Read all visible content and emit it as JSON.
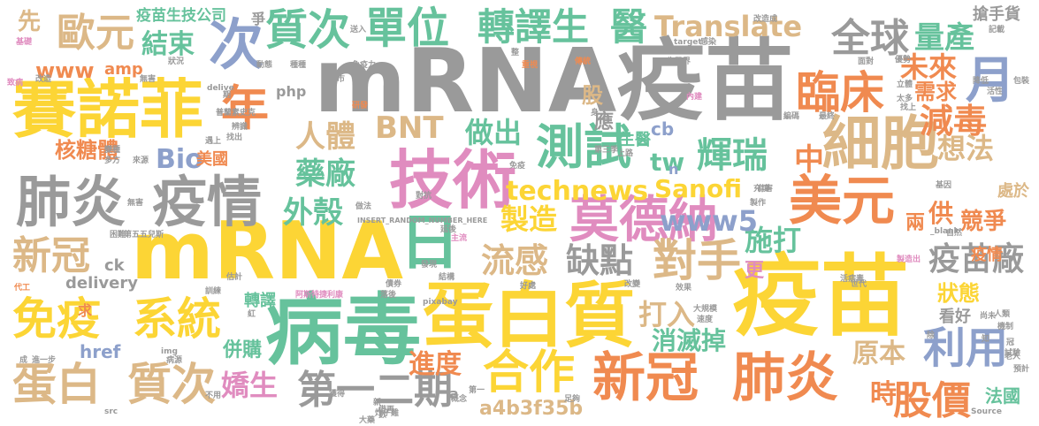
{
  "palette": {
    "gray": "#9a9a9a",
    "yellow": "#fcd535",
    "green": "#66c29c",
    "orange": "#f08a50",
    "tan": "#dcb887",
    "pink": "#e08cbf",
    "blue": "#8da0cb",
    "lime": "#a6d34f"
  },
  "words": [
    {
      "text": "mRNA疫苗",
      "color": "gray"
    },
    {
      "text": "賽諾菲",
      "color": "yellow"
    },
    {
      "text": "技術",
      "color": "pink"
    },
    {
      "text": "mRNA",
      "color": "yellow"
    },
    {
      "text": "日",
      "color": "green"
    },
    {
      "text": "病毒",
      "color": "green"
    },
    {
      "text": "蛋白質",
      "color": "yellow"
    },
    {
      "text": "疫苗",
      "color": "yellow"
    },
    {
      "text": "肺炎",
      "color": "gray"
    },
    {
      "text": "疫情",
      "color": "gray"
    },
    {
      "text": "細胞",
      "color": "tan"
    },
    {
      "text": "質次",
      "color": "green"
    },
    {
      "text": "單位",
      "color": "green"
    },
    {
      "text": "轉譯生",
      "color": "green"
    },
    {
      "text": "醫",
      "color": "green"
    },
    {
      "text": "次",
      "color": "blue"
    },
    {
      "text": "歐元",
      "color": "tan"
    },
    {
      "text": "年",
      "color": "orange"
    },
    {
      "text": "測試",
      "color": "green"
    },
    {
      "text": "莫德納",
      "color": "pink"
    },
    {
      "text": "美元",
      "color": "orange"
    },
    {
      "text": "臨床",
      "color": "orange"
    },
    {
      "text": "全球",
      "color": "gray"
    },
    {
      "text": "量產",
      "color": "green"
    },
    {
      "text": "月",
      "color": "blue"
    },
    {
      "text": "Translate",
      "color": "tan"
    },
    {
      "text": "疫苗生技公司",
      "color": "green"
    },
    {
      "text": "結束",
      "color": "green"
    },
    {
      "text": "www",
      "color": "orange"
    },
    {
      "text": "amp",
      "color": "orange"
    },
    {
      "text": "Bio",
      "color": "blue"
    },
    {
      "text": "BNT",
      "color": "tan"
    },
    {
      "text": "人體",
      "color": "tan"
    },
    {
      "text": "核糖體",
      "color": "orange"
    },
    {
      "text": "美國",
      "color": "orange"
    },
    {
      "text": "外殼",
      "color": "green"
    },
    {
      "text": "藥廠",
      "color": "green"
    },
    {
      "text": "technews",
      "color": "yellow"
    },
    {
      "text": "Sanofi",
      "color": "yellow"
    },
    {
      "text": "做出",
      "color": "green"
    },
    {
      "text": "tw",
      "color": "green"
    },
    {
      "text": "輝瑞",
      "color": "green"
    },
    {
      "text": "製造",
      "color": "yellow"
    },
    {
      "text": "施打",
      "color": "green"
    },
    {
      "text": "新冠",
      "color": "tan"
    },
    {
      "text": "新冠",
      "color": "orange"
    },
    {
      "text": "肺炎",
      "color": "orange"
    },
    {
      "text": "免疫",
      "color": "yellow"
    },
    {
      "text": "系統",
      "color": "yellow"
    },
    {
      "text": "蛋白",
      "color": "tan"
    },
    {
      "text": "質次",
      "color": "tan"
    },
    {
      "text": "流感",
      "color": "tan"
    },
    {
      "text": "缺點",
      "color": "gray"
    },
    {
      "text": "對手",
      "color": "tan"
    },
    {
      "text": "www5",
      "color": "blue"
    },
    {
      "text": "疫苗廠",
      "color": "gray"
    },
    {
      "text": "合作",
      "color": "yellow"
    },
    {
      "text": "第一二期",
      "color": "gray"
    },
    {
      "text": "進度",
      "color": "orange"
    },
    {
      "text": "打入",
      "color": "tan"
    },
    {
      "text": "消滅掉",
      "color": "green"
    },
    {
      "text": "股價",
      "color": "orange"
    },
    {
      "text": "利用",
      "color": "blue"
    },
    {
      "text": "嬌生",
      "color": "pink"
    },
    {
      "text": "減毒",
      "color": "orange"
    },
    {
      "text": "想法",
      "color": "tan"
    },
    {
      "text": "未來",
      "color": "orange"
    },
    {
      "text": "需求",
      "color": "orange"
    },
    {
      "text": "原本",
      "color": "tan"
    },
    {
      "text": "a4b3f35b",
      "color": "tan"
    },
    {
      "text": "delivery",
      "color": "gray"
    },
    {
      "text": "href",
      "color": "blue"
    },
    {
      "text": "併購",
      "color": "green"
    },
    {
      "text": "轉譯",
      "color": "green"
    },
    {
      "text": "狀態",
      "color": "yellow"
    },
    {
      "text": "看好",
      "color": "gray"
    },
    {
      "text": "法國",
      "color": "green"
    },
    {
      "text": "時",
      "color": "orange"
    },
    {
      "text": "競爭",
      "color": "orange"
    },
    {
      "text": "處於",
      "color": "tan"
    },
    {
      "text": "搶手貨",
      "color": "gray"
    },
    {
      "text": "ck",
      "color": "gray"
    },
    {
      "text": "php",
      "color": "gray"
    },
    {
      "text": "先",
      "color": "tan"
    },
    {
      "text": "爭",
      "color": "gray"
    },
    {
      "text": "股",
      "color": "tan"
    },
    {
      "text": "cb",
      "color": "blue"
    },
    {
      "text": "生醫",
      "color": "green"
    },
    {
      "text": "應",
      "color": "gray"
    },
    {
      "text": "求",
      "color": "orange"
    },
    {
      "text": "更",
      "color": "pink"
    },
    {
      "text": "疫情",
      "color": "orange"
    },
    {
      "text": "INSERT_RANDOM_NUMBER_HERE",
      "color": "gray"
    },
    {
      "text": "pixabay",
      "color": "gray"
    },
    {
      "text": "src",
      "color": "gray"
    },
    {
      "text": "Source",
      "color": "gray"
    },
    {
      "text": "img",
      "color": "gray"
    },
    {
      "text": "delive",
      "color": "gray"
    },
    {
      "text": "兩",
      "color": "orange"
    },
    {
      "text": "中",
      "color": "orange"
    },
    {
      "text": "供",
      "color": "orange"
    },
    {
      "text": "n",
      "color": "blue"
    },
    {
      "text": "a",
      "color": "gray"
    },
    {
      "text": "基礎",
      "color": "pink"
    },
    {
      "text": "致病",
      "color": "pink"
    },
    {
      "text": "代工",
      "color": "orange"
    },
    {
      "text": "成",
      "color": "gray"
    },
    {
      "text": "進一步",
      "color": "gray"
    },
    {
      "text": "預計",
      "color": "gray"
    },
    {
      "text": "包裝",
      "color": "gray"
    },
    {
      "text": "記載",
      "color": "gray"
    },
    {
      "text": "炸子雞",
      "color": "gray"
    },
    {
      "text": "阿斯特捷利康",
      "color": "pink"
    },
    {
      "text": "送入",
      "color": "gray"
    },
    {
      "text": "上市",
      "color": "gray"
    },
    {
      "text": "無害",
      "color": "gray"
    },
    {
      "text": "效果",
      "color": "gray"
    },
    {
      "text": "第三季",
      "color": "gray"
    },
    {
      "text": "改造成",
      "color": "gray"
    },
    {
      "text": "生醫界",
      "color": "gray"
    },
    {
      "text": "概念",
      "color": "gray"
    },
    {
      "text": "足夠",
      "color": "gray"
    },
    {
      "text": "主流",
      "color": "pink"
    },
    {
      "text": "免疫力",
      "color": "gray"
    },
    {
      "text": "製造出",
      "color": "pink"
    },
    {
      "text": "發現",
      "color": "gray"
    },
    {
      "text": "結構",
      "color": "gray"
    },
    {
      "text": "債券",
      "color": "gray"
    },
    {
      "text": "傳統",
      "color": "orange"
    },
    {
      "text": "重視",
      "color": "orange"
    },
    {
      "text": "研發",
      "color": "orange"
    },
    {
      "text": "變種",
      "color": "gray"
    },
    {
      "text": "多方",
      "color": "gray"
    },
    {
      "text": "第五五兒斯",
      "color": "gray"
    },
    {
      "text": "困難",
      "color": "gray"
    },
    {
      "text": "活病毒",
      "color": "gray"
    },
    {
      "text": "大規模",
      "color": "gray"
    },
    {
      "text": "落後",
      "color": "gray"
    },
    {
      "text": "好處",
      "color": "gray"
    },
    {
      "text": "人類",
      "color": "gray"
    },
    {
      "text": "機制",
      "color": "gray"
    },
    {
      "text": "老人",
      "color": "gray"
    },
    {
      "text": "試驗",
      "color": "gray"
    },
    {
      "text": "降低",
      "color": "gray"
    },
    {
      "text": "感染",
      "color": "gray"
    },
    {
      "text": "target",
      "color": "gray"
    },
    {
      "text": "_blank",
      "color": "gray"
    },
    {
      "text": "自然",
      "color": "gray"
    },
    {
      "text": "基因",
      "color": "gray"
    },
    {
      "text": "編碼",
      "color": "gray"
    },
    {
      "text": "最終",
      "color": "gray"
    },
    {
      "text": "立體",
      "color": "gray"
    },
    {
      "text": "活性",
      "color": "gray"
    },
    {
      "text": "太多",
      "color": "gray"
    },
    {
      "text": "找上",
      "color": "gray"
    },
    {
      "text": "面對",
      "color": "gray"
    },
    {
      "text": "優勢",
      "color": "gray"
    },
    {
      "text": "有害",
      "color": "gray"
    },
    {
      "text": "身",
      "color": "gray"
    },
    {
      "text": "內建",
      "color": "pink"
    },
    {
      "text": "延後",
      "color": "gray"
    },
    {
      "text": "辨識",
      "color": "gray"
    },
    {
      "text": "找出",
      "color": "gray"
    },
    {
      "text": "遇上",
      "color": "gray"
    },
    {
      "text": "來源",
      "color": "gray"
    },
    {
      "text": "上路",
      "color": "gray"
    },
    {
      "text": "免疫",
      "color": "gray"
    },
    {
      "text": "對抗",
      "color": "gray"
    },
    {
      "text": "改變",
      "color": "gray"
    },
    {
      "text": "充填",
      "color": "gray"
    },
    {
      "text": "估計",
      "color": "gray"
    },
    {
      "text": "訓練",
      "color": "gray"
    },
    {
      "text": "紅",
      "color": "gray"
    },
    {
      "text": "大藥",
      "color": "gray"
    },
    {
      "text": "新",
      "color": "gray"
    },
    {
      "text": "第一",
      "color": "gray"
    },
    {
      "text": "不用",
      "color": "gray"
    },
    {
      "text": "病源",
      "color": "gray"
    },
    {
      "text": "尚未",
      "color": "gray"
    },
    {
      "text": "速度",
      "color": "gray"
    },
    {
      "text": "借再",
      "color": "gray"
    },
    {
      "text": "數",
      "color": "gray"
    },
    {
      "text": "除",
      "color": "gray"
    },
    {
      "text": "知",
      "color": "gray"
    },
    {
      "text": "冠",
      "color": "gray"
    },
    {
      "text": "世代",
      "color": "gray"
    },
    {
      "text": "期",
      "color": "gray"
    },
    {
      "text": "整",
      "color": "gray"
    },
    {
      "text": "狀況",
      "color": "gray"
    },
    {
      "text": "動態",
      "color": "gray"
    },
    {
      "text": "種種",
      "color": "gray"
    },
    {
      "text": "普蘭素史克",
      "color": "gray"
    },
    {
      "text": "改造",
      "color": "gray"
    },
    {
      "text": "無害",
      "color": "gray"
    },
    {
      "text": "做法",
      "color": "gray"
    },
    {
      "text": "獲得",
      "color": "gray"
    },
    {
      "text": "製作",
      "color": "gray"
    }
  ]
}
